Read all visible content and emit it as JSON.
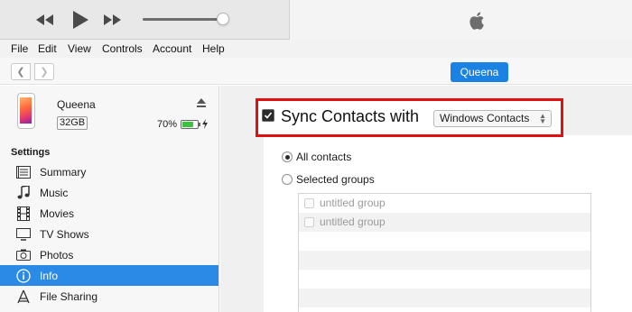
{
  "menu": [
    "File",
    "Edit",
    "View",
    "Controls",
    "Account",
    "Help"
  ],
  "device_pill": "Queena",
  "device": {
    "name": "Queena",
    "capacity": "32GB",
    "battery": "70%"
  },
  "sidebar": {
    "section": "Settings",
    "items": [
      {
        "label": "Summary",
        "icon": "summary-icon"
      },
      {
        "label": "Music",
        "icon": "music-note-icon"
      },
      {
        "label": "Movies",
        "icon": "film-icon"
      },
      {
        "label": "TV Shows",
        "icon": "tv-icon"
      },
      {
        "label": "Photos",
        "icon": "camera-icon"
      },
      {
        "label": "Info",
        "icon": "info-icon",
        "selected": true
      },
      {
        "label": "File Sharing",
        "icon": "file-sharing-icon"
      }
    ]
  },
  "sync": {
    "label": "Sync Contacts with",
    "checked": true,
    "source": "Windows Contacts",
    "options": [
      {
        "label": "All contacts",
        "selected": true
      },
      {
        "label": "Selected groups",
        "selected": false
      }
    ],
    "groups": [
      "untitled group",
      "untitled group"
    ]
  },
  "colors": {
    "accent": "#2a8ae6",
    "highlight": "#e01010"
  }
}
